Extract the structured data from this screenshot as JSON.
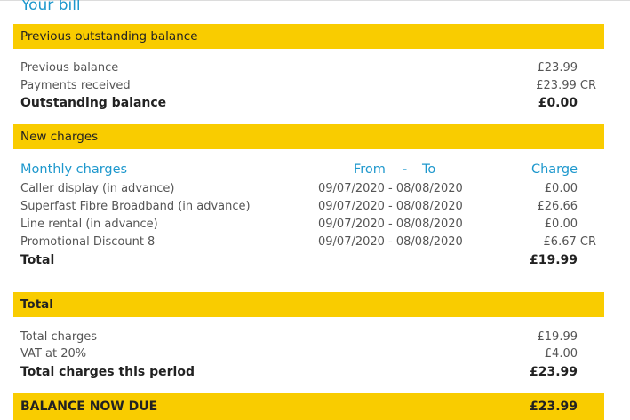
{
  "title": "Your bill",
  "previous": {
    "heading": "Previous outstanding balance",
    "rows": [
      {
        "label": "Previous balance",
        "amount": "£23.99"
      },
      {
        "label": "Payments received",
        "amount": "£23.99 CR"
      }
    ],
    "outstanding": {
      "label": "Outstanding balance",
      "amount": "£0.00"
    }
  },
  "new_charges": {
    "heading": "New charges",
    "columns": {
      "monthly": "Monthly charges",
      "from": "From",
      "dash": "-",
      "to": "To",
      "charge": "Charge"
    },
    "rows": [
      {
        "label": "Caller display (in advance)",
        "period": "09/07/2020 - 08/08/2020",
        "amount": "£0.00"
      },
      {
        "label": "Superfast Fibre Broadband (in advance)",
        "period": "09/07/2020 - 08/08/2020",
        "amount": "£26.66"
      },
      {
        "label": "Line rental (in advance)",
        "period": "09/07/2020 - 08/08/2020",
        "amount": "£0.00"
      },
      {
        "label": "Promotional Discount 8",
        "period": "09/07/2020 - 08/08/2020",
        "amount": "£6.67 CR"
      }
    ],
    "total": {
      "label": "Total",
      "amount": "£19.99"
    }
  },
  "totals": {
    "heading": "Total",
    "rows": [
      {
        "label": "Total charges",
        "amount": "£19.99"
      },
      {
        "label": "VAT at 20%",
        "amount": "£4.00"
      }
    ],
    "period_total": {
      "label": "Total charges this period",
      "amount": "£23.99"
    }
  },
  "balance_due": {
    "label": "BALANCE NOW DUE",
    "amount": "£23.99"
  },
  "colors": {
    "accent_yellow": "#f9cc00",
    "heading_blue": "#1e98cd",
    "text_grey": "#555555"
  }
}
